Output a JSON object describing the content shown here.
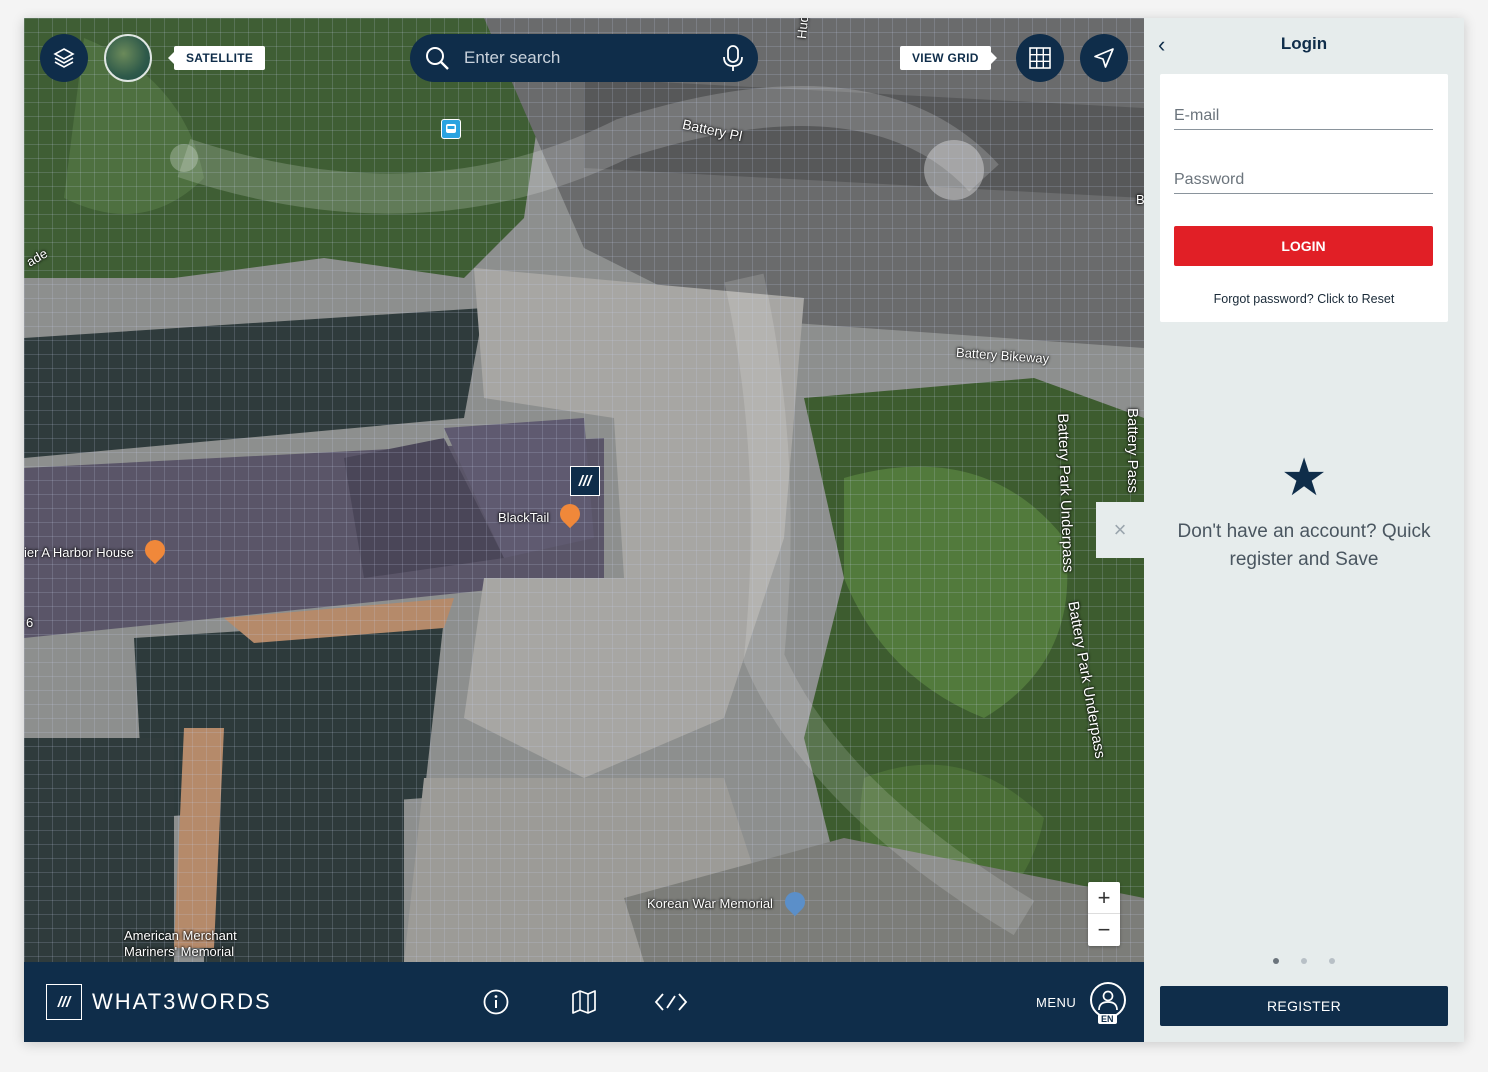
{
  "map": {
    "layer_tag": "SATELLITE",
    "view_grid_tag": "VIEW GRID",
    "search_placeholder": "Enter search",
    "labels": {
      "street_hudson": "Hudson R",
      "street_battery_pl": "Battery Pl",
      "street_battery_bikeway": "Battery Bikeway",
      "underpass_1": "Battery Park Underpass",
      "underpass_2": "Battery Park Underpass",
      "underpass_3": "Battery Pass",
      "promenade": "ade",
      "poi_blacktail": "BlackTail",
      "poi_harbor_house": "ier A Harbor House",
      "poi_korean_memorial": "Korean War Memorial",
      "poi_merchant_memorial": "American Merchant Mariners' Memorial",
      "side_number": "6",
      "edge_letter": "B"
    },
    "w3w_marker": "///",
    "zoom_in": "+",
    "zoom_out": "−",
    "close_symbol": "×"
  },
  "footer": {
    "logo_mark": "///",
    "logo_text": "WHAT3WORDS",
    "menu_label": "MENU",
    "lang": "EN"
  },
  "panel": {
    "back_symbol": "‹",
    "title": "Login",
    "email_placeholder": "E-mail",
    "password_placeholder": "Password",
    "login_button": "LOGIN",
    "forgot_text": "Forgot password? Click to Reset",
    "star_symbol": "★",
    "promo_text": "Don't have an account? Quick register and Save",
    "register_button": "REGISTER"
  },
  "colors": {
    "brand_navy": "#0f2d4a",
    "login_red": "#e11f26",
    "panel_bg": "#e6ecec",
    "poi_orange": "#f0883a",
    "poi_blue": "#5b8fc9"
  },
  "icons": [
    "layers-icon",
    "search-icon",
    "microphone-icon",
    "grid-icon",
    "navigation-arrow-icon",
    "bus-stop-icon",
    "info-icon",
    "map-icon",
    "code-icon",
    "user-icon",
    "back-chevron-icon",
    "star-icon",
    "close-icon"
  ]
}
